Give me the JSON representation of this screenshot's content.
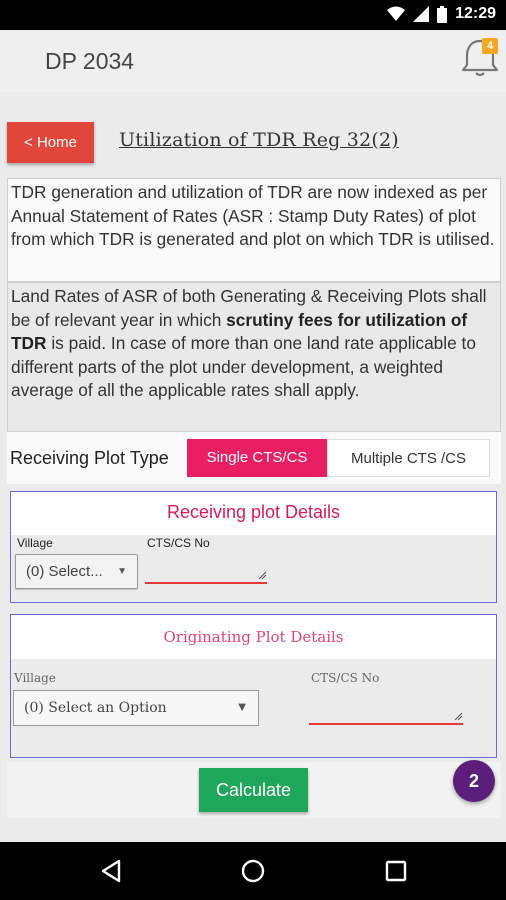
{
  "status": {
    "time": "12:29"
  },
  "appbar": {
    "title": "DP 2034",
    "notification_count": "4"
  },
  "page": {
    "home_label": "< Home",
    "heading": "Utilization of TDR Reg 32(2)"
  },
  "info": {
    "para1": "TDR generation and utilization of TDR are now indexed as per Annual Statement of Rates (ASR : Stamp Duty Rates) of plot from which TDR is generated and plot on which TDR is utilised.",
    "para2_part1": "Land Rates of ASR of both Generating & Receiving Plots shall be of relevant year in which ",
    "para2_bold": "scrutiny fees for utilization of TDR",
    "para2_part2": " is paid. In case of more than one land rate applicable to different parts of the plot under development, a weighted average of all the applicable rates shall apply."
  },
  "plot_type": {
    "label": "Receiving Plot Type",
    "options": [
      "Single CTS/CS",
      "Multiple CTS /CS"
    ],
    "selected": "Single CTS/CS"
  },
  "receiving": {
    "title": "Receiving plot Details",
    "village_label": "Village",
    "village_value": "(0) Select...",
    "cts_label": "CTS/CS No",
    "cts_value": ""
  },
  "originating": {
    "title": "Originating Plot Details",
    "village_label": "Village",
    "village_value": "(0) Select an Option",
    "cts_label": "CTS/CS No",
    "cts_value": ""
  },
  "actions": {
    "calculate_label": "Calculate",
    "fab_label": "2"
  },
  "colors": {
    "accent": "#e91e63",
    "home": "#e0463a",
    "calculate": "#1ea65a",
    "fab": "#5b1e7a",
    "panel_border": "#6a6ad6"
  }
}
